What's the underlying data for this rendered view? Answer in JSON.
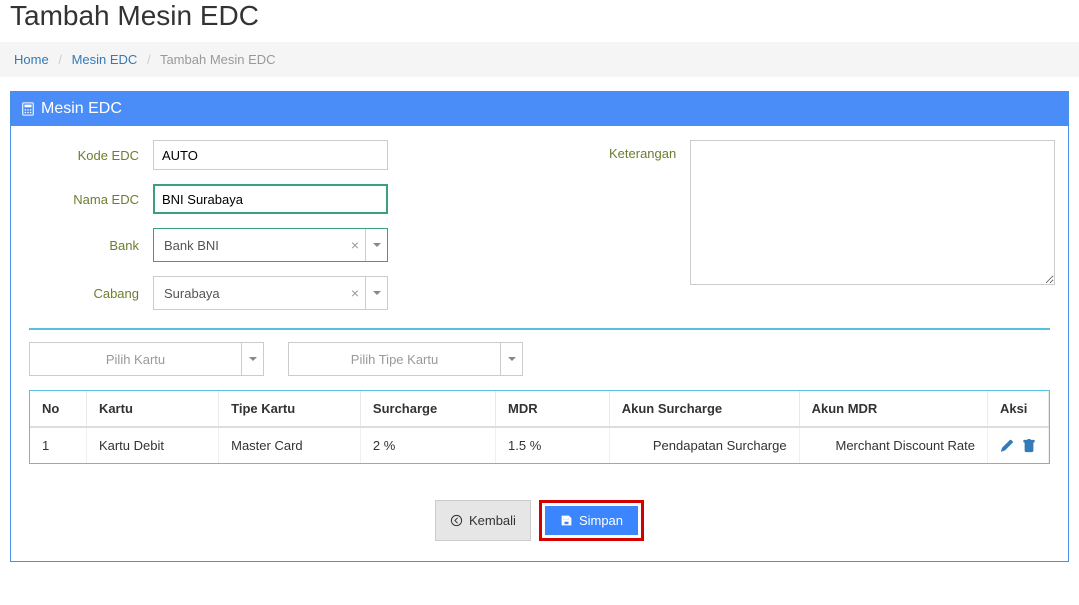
{
  "page_title": "Tambah Mesin EDC",
  "breadcrumb": {
    "home": "Home",
    "parent": "Mesin EDC",
    "current": "Tambah Mesin EDC"
  },
  "panel_title": "Mesin EDC",
  "form": {
    "kode_edc_label": "Kode EDC",
    "kode_edc_value": "AUTO",
    "nama_edc_label": "Nama EDC",
    "nama_edc_value": "BNI Surabaya",
    "bank_label": "Bank",
    "bank_value": "Bank BNI",
    "cabang_label": "Cabang",
    "cabang_value": "Surabaya",
    "keterangan_label": "Keterangan",
    "keterangan_value": ""
  },
  "filters": {
    "kartu_placeholder": "Pilih Kartu",
    "tipe_placeholder": "Pilih Tipe Kartu"
  },
  "table": {
    "headers": {
      "no": "No",
      "kartu": "Kartu",
      "tipe": "Tipe Kartu",
      "surcharge": "Surcharge",
      "mdr": "MDR",
      "akun_surcharge": "Akun Surcharge",
      "akun_mdr": "Akun MDR",
      "aksi": "Aksi"
    },
    "rows": [
      {
        "no": "1",
        "kartu": "Kartu Debit",
        "tipe": "Master Card",
        "surcharge": "2 %",
        "mdr": "1.5 %",
        "akun_surcharge": "Pendapatan Surcharge",
        "akun_mdr": "Merchant Discount Rate"
      }
    ]
  },
  "buttons": {
    "kembali": "Kembali",
    "simpan": "Simpan"
  }
}
